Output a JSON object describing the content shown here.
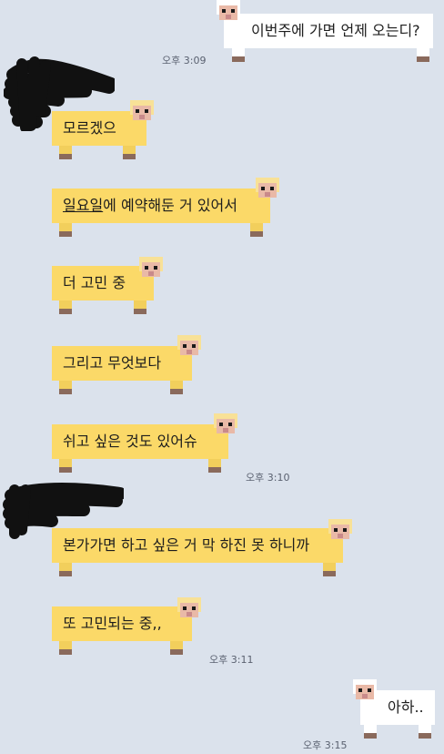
{
  "messages": [
    {
      "id": "m1",
      "side": "right",
      "text": "이번주에 가면 언제 오는디?"
    },
    {
      "id": "m2",
      "side": "left",
      "text": "모르겠으"
    },
    {
      "id": "m3",
      "side": "left",
      "text_underlined": "일요일",
      "text_rest": "에 예약해둔 거 있어서"
    },
    {
      "id": "m4",
      "side": "left",
      "text": "더 고민 중"
    },
    {
      "id": "m5",
      "side": "left",
      "text": "그리고 무엇보다"
    },
    {
      "id": "m6",
      "side": "left",
      "text": "쉬고 싶은 것도 있어슈"
    },
    {
      "id": "m7",
      "side": "left",
      "text": "본가가면 하고 싶은 거 막 하진 못 하니까"
    },
    {
      "id": "m8",
      "side": "left",
      "text": "또 고민되는 중,,"
    },
    {
      "id": "m9",
      "side": "right",
      "text": "아하.."
    }
  ],
  "timestamps": {
    "t1": "오후 3:09",
    "t2": "오후 3:10",
    "t3": "오후 3:11",
    "t4": "오후 3:15"
  },
  "colors": {
    "background": "#dbe2ec",
    "bubble_yellow": "#fbd968",
    "bubble_white": "#ffffff",
    "redaction": "#111111"
  }
}
